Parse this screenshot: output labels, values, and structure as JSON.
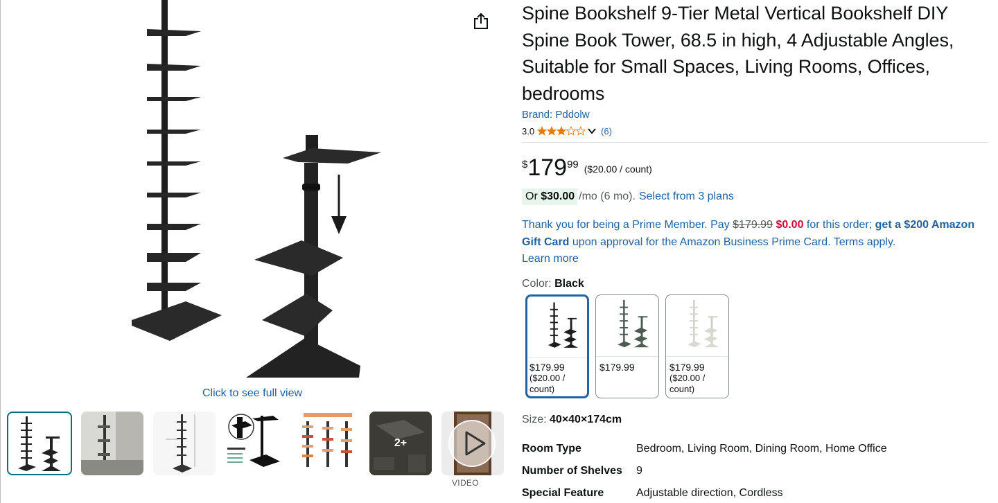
{
  "gallery": {
    "full_view_link": "Click to see full view",
    "more_count": "2+",
    "video_label": "VIDEO",
    "thumbnails": [
      "product-main",
      "product-lifestyle-room",
      "product-dimensions",
      "product-features",
      "assembly-methods",
      "more-images",
      "product-video"
    ]
  },
  "product": {
    "title": "Spine Bookshelf 9-Tier Metal Vertical Bookshelf DIY Spine Book Tower, 68.5 in high, 4 Adjustable Angles, Suitable for Small Spaces, Living Rooms, Offices, bedrooms",
    "brand_link": "Brand: Pddolw",
    "rating": "3.0",
    "rating_stars": 3,
    "rating_count": "(6)",
    "price_symbol": "$",
    "price_whole": "179",
    "price_fraction": "99",
    "unit_price": "($20.00 / count)",
    "monthly_prefix": "Or ",
    "monthly_amount": "$30.00",
    "monthly_suffix": "/mo (6 mo).",
    "plans_link": "Select from 3 plans",
    "prime_text_1": "Thank you for being a Prime Member. Pay ",
    "prime_old_price": "$179.99",
    "prime_new_price": "$0.00",
    "prime_text_2": " for this order; ",
    "prime_bold": "get a $200 Amazon Gift Card",
    "prime_text_3": " upon approval for the Amazon Business Prime Card. Terms apply.",
    "learn_more": "Learn more",
    "color_label": "Color: ",
    "color_value": "Black",
    "swatches": [
      {
        "price": "$179.99",
        "unit": "($20.00 / count)",
        "color": "#1d1d1d"
      },
      {
        "price": "$179.99",
        "unit": "",
        "color": "#4c5a52"
      },
      {
        "price": "$179.99",
        "unit": "($20.00 / count)",
        "color": "#d9d9d4"
      }
    ],
    "size_label": "Size: ",
    "size_value": "40×40×174cm",
    "specs": [
      {
        "key": "Room Type",
        "value": "Bedroom, Living Room, Dining Room, Home Office"
      },
      {
        "key": "Number of Shelves",
        "value": "9"
      },
      {
        "key": "Special Feature",
        "value": "Adjustable direction, Cordless"
      }
    ]
  },
  "colors": {
    "link": "#2162A1",
    "price_red": "#CC0C39",
    "selected_border": "#2162A1",
    "thumb_selected": "#007185",
    "monthly_badge_bg": "#e7f5ec",
    "star": "#E67A00"
  }
}
